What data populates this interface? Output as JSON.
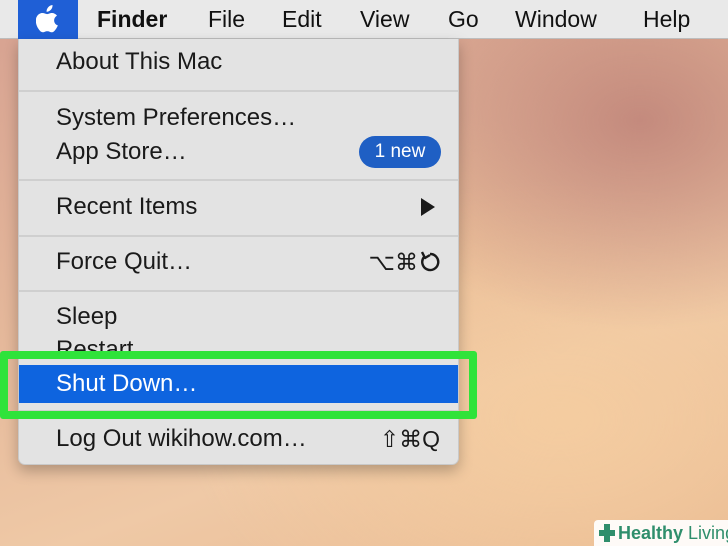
{
  "menubar": {
    "items": [
      "Finder",
      "File",
      "Edit",
      "View",
      "Go",
      "Window",
      "Help"
    ]
  },
  "apple_menu": {
    "about": "About This Mac",
    "system_preferences": "System Preferences…",
    "app_store": "App Store…",
    "app_store_badge": "1 new",
    "recent_items": "Recent Items",
    "force_quit": "Force Quit…",
    "force_quit_shortcut": "⌥⌘",
    "sleep": "Sleep",
    "restart": "Restart…",
    "shut_down": "Shut Down…",
    "log_out": "Log Out wikihow.com…",
    "log_out_shortcut": "⇧⌘Q"
  },
  "highlight_color": "#2fe33a",
  "selection_color": "#0e64df",
  "watermark": {
    "word1": "Healthy",
    "word2": "Living"
  }
}
